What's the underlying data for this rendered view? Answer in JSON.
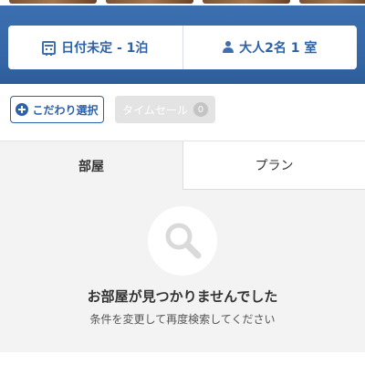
{
  "search": {
    "date_label": "日付未定 - 1泊",
    "guests_label": "大人2名 1 室",
    "date_icon": "calendar-icon",
    "guests_icon": "user-icon"
  },
  "filters": {
    "kodawari_label": "こだわり選択",
    "kodawari_icon": "plus-circle-icon",
    "timesale_label": "タイムセール",
    "timesale_count": "0"
  },
  "tabs": [
    {
      "label": "部屋",
      "active": true
    },
    {
      "label": "プラン",
      "active": false
    }
  ],
  "empty_state": {
    "icon": "search-icon",
    "title": "お部屋が見つかりませんでした",
    "subtitle": "条件を変更して再度検索してください"
  },
  "colors": {
    "brand_blue": "#3466a6",
    "link_blue": "#2e62a8"
  }
}
